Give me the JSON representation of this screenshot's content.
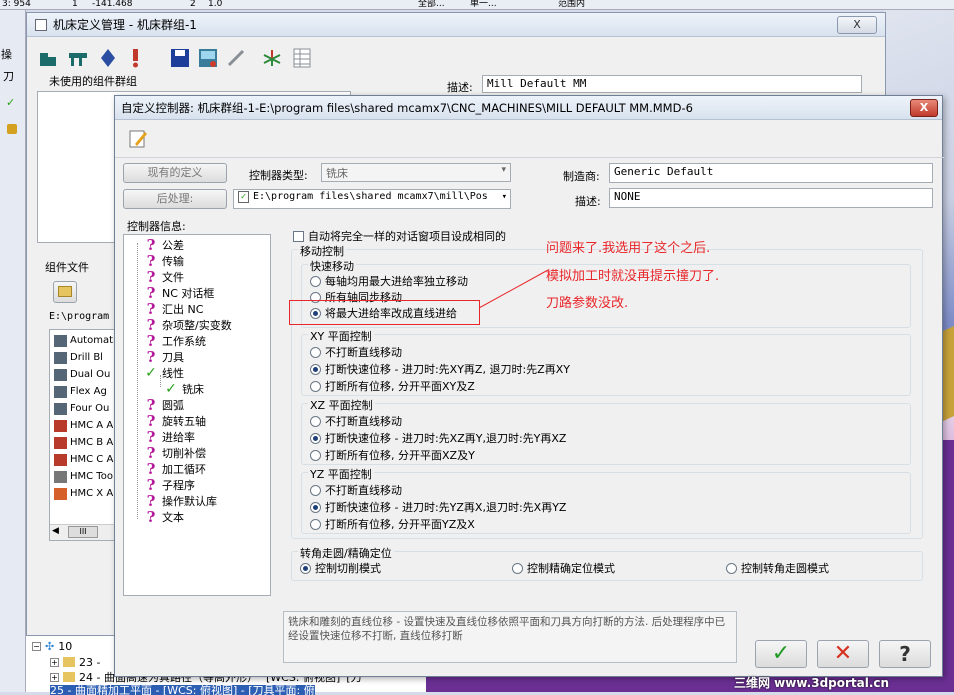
{
  "background": {
    "coords_left": "3: 954",
    "coords_mid": "1",
    "coords_val": "-141.468",
    "coords_2": "2",
    "coords_3": "1.0",
    "drop_all": "全部...",
    "drop_single": "单一...",
    "drop_range": "范围内",
    "left_strip_1": "操",
    "left_strip_2": "刀",
    "tree_10": "10",
    "tree_23": "23 -",
    "tree_24": "24 - 曲面高速为真路径（等高外形）",
    "tree_24_tail": "[WCS: 俯视图]",
    "tree_24_end": "[刀",
    "tree_25": "25 - 曲面精加工平面 - [WCS: 俯视图] - [刀具平面: 俯"
  },
  "manager": {
    "title": "机床定义管理 - 机床群组-1",
    "close": "X",
    "unused_label": "未使用的组件群组",
    "desc_label": "描述:",
    "desc_value": "Mill Default MM",
    "component_files_label": "组件文件",
    "path_value": "E:\\program",
    "components": [
      "Automati",
      "Drill Bl",
      "Dual Ou",
      "Flex Ag",
      "Four Ou",
      "HMC A A",
      "HMC B A",
      "HMC C A",
      "HMC Too",
      "HMC X A"
    ],
    "scroll_thumb": "III"
  },
  "dialog": {
    "title": "自定义控制器: 机床群组-1-E:\\program files\\shared mcamx7\\CNC_MACHINES\\MILL DEFAULT MM.MMD-6",
    "close": "X",
    "btn_existing": "现有的定义",
    "btn_post": "后处理:",
    "controller_type_label": "控制器类型:",
    "controller_type_value": "铣床",
    "post_path": "E:\\program files\\shared mcamx7\\mill\\Pos",
    "manufacturer_label": "制造商:",
    "manufacturer_value": "Generic Default",
    "desc_label": "描述:",
    "desc_value": "NONE",
    "info_label": "控制器信息:",
    "tree": [
      "公差",
      "传输",
      "文件",
      "NC 对话框",
      "汇出 NC",
      "杂项整/实变数",
      "工作系统",
      "刀具",
      "线性",
      "铣床",
      "圆弧",
      "旋转五轴",
      "进给率",
      "切削补偿",
      "加工循环",
      "子程序",
      "操作默认库",
      "文本"
    ],
    "auto_set": "自动将完全一样的对话窗项目设成相同的",
    "move_control": "移动控制",
    "rapid_group": "快速移动",
    "rapid_opts": [
      "每轴均用最大进给率独立移动",
      "所有轴同步移动",
      "将最大进给率改成直线进给"
    ],
    "xy_group": "XY 平面控制",
    "xy_opts": [
      "不打断直线移动",
      "打断快速位移 - 进刀时:先XY再Z, 退刀时:先Z再XY",
      "打断所有位移, 分开平面XY及Z"
    ],
    "xz_group": "XZ 平面控制",
    "xz_opts": [
      "不打断直线移动",
      "打断快速位移 - 进刀时:先XZ再Y,退刀时:先Y再XZ",
      "打断所有位移, 分开平面XZ及Y"
    ],
    "yz_group": "YZ 平面控制",
    "yz_opts": [
      "不打断直线移动",
      "打断快速位移 - 进刀时:先YZ再X,退刀时:先X再YZ",
      "打断所有位移, 分开平面YZ及X"
    ],
    "corner_group": "转角走圆/精确定位",
    "corner_opts": [
      "控制切削模式",
      "控制精确定位模式",
      "控制转角走圆模式"
    ],
    "help_text": "铣床和雕刻的直线位移 - 设置快速及直线位移依照平面和刀具方向打断的方法. 后处理程序中已经设置快速位移不打断, 直线位移打断"
  },
  "annotation": {
    "line1": "问题来了.我选用了这个之后.",
    "line2": "模拟加工时就没再提示撞刀了.",
    "line3": "刀路参数没改.",
    "color": "#e8272b"
  },
  "watermark": "三维网 www.3dportal.cn"
}
